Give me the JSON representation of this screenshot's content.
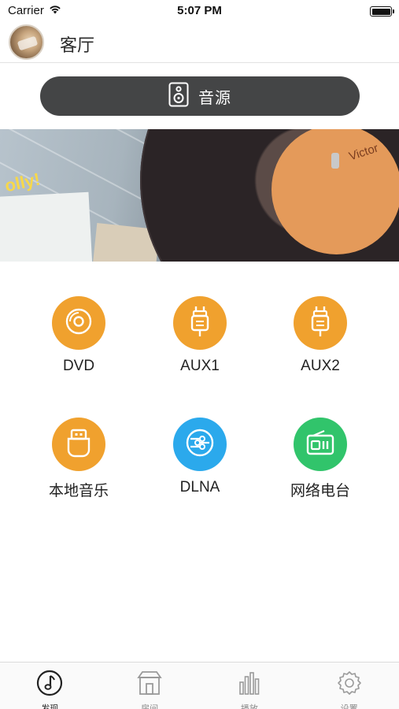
{
  "status_bar": {
    "carrier": "Carrier",
    "time": "5:07 PM"
  },
  "header": {
    "room_title": "客厅"
  },
  "source_button": {
    "label": "音源"
  },
  "sources": [
    {
      "label": "DVD",
      "icon": "disc-icon",
      "color": "#f0a12e"
    },
    {
      "label": "AUX1",
      "icon": "aux-plug-icon",
      "color": "#f0a12e"
    },
    {
      "label": "AUX2",
      "icon": "aux-plug-icon",
      "color": "#f0a12e"
    },
    {
      "label": "本地音乐",
      "icon": "usb-icon",
      "color": "#f0a12e"
    },
    {
      "label": "DLNA",
      "icon": "dlna-icon",
      "color": "#2ba9ec"
    },
    {
      "label": "网络电台",
      "icon": "radio-icon",
      "color": "#31c46b"
    }
  ],
  "tabbar": {
    "items": [
      {
        "label": "发现",
        "icon": "music-note-icon",
        "active": true
      },
      {
        "label": "房间",
        "icon": "house-icon",
        "active": false
      },
      {
        "label": "播放",
        "icon": "bars-icon",
        "active": false
      },
      {
        "label": "设置",
        "icon": "gear-icon",
        "active": false
      }
    ]
  },
  "banner": {
    "script_text": "olly!",
    "label_text": "Victor"
  }
}
